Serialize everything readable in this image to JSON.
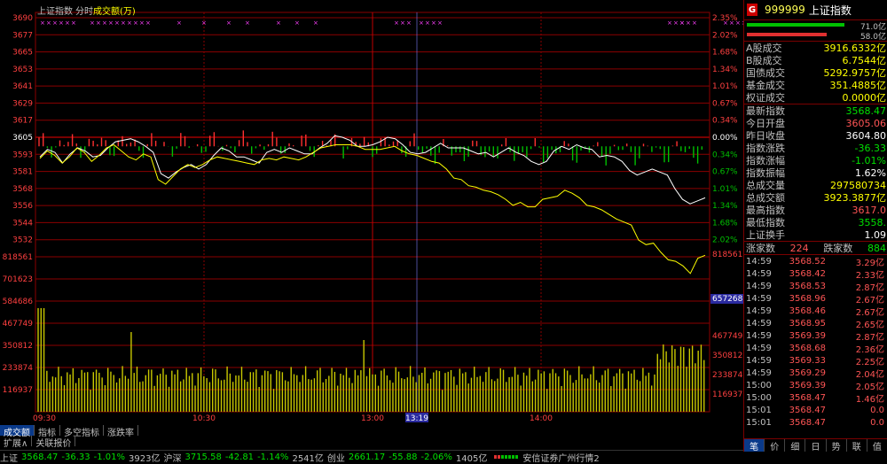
{
  "chart": {
    "header_index": "上证指数",
    "header_period": "分时",
    "header_measure": "成交额(万)",
    "price_ticks_left": [
      "3690",
      "3677",
      "3665",
      "3653",
      "3641",
      "3629",
      "3617",
      "3605",
      "3593",
      "3581",
      "3568",
      "3556",
      "3544",
      "3532"
    ],
    "pct_ticks_right": [
      "2.35%",
      "2.02%",
      "1.68%",
      "1.34%",
      "1.01%",
      "0.67%",
      "0.34%",
      "0.00%",
      "0.34%",
      "0.67%",
      "1.01%",
      "1.34%",
      "1.68%",
      "2.02%"
    ],
    "vol_ticks_left": [
      "818561",
      "701623",
      "584686",
      "467749",
      "350812",
      "233874",
      "116937"
    ],
    "vol_ticks_right": [
      "818561",
      "657268",
      "467749",
      "350812",
      "233874",
      "116937"
    ],
    "cursor_value": "657268",
    "time_labels": [
      "09:30",
      "10:30",
      "13:00",
      "13:19",
      "14:00"
    ],
    "colors": {
      "grid": "#8b0000",
      "white_line": "#ffffff",
      "yellow_line": "#ffff00",
      "up": "#ff3030",
      "down": "#00c000",
      "volume": "#c8c800",
      "cursor_box": "#2a2aa0"
    }
  },
  "chart_data": {
    "type": "line",
    "series": [
      {
        "values": [
          3598,
          3603,
          3601,
          3594,
          3600,
          3604,
          3602,
          3598,
          3599,
          3604,
          3608,
          3609,
          3610,
          3608,
          3605,
          3601,
          3587,
          3584,
          3588,
          3591,
          3593,
          3590,
          3593,
          3599,
          3604,
          3602,
          3598,
          3598,
          3596,
          3594,
          3601,
          3603,
          3601,
          3604,
          3602,
          3600,
          3600,
          3604,
          3607,
          3612,
          3611,
          3609,
          3605,
          3605,
          3606,
          3608,
          3611,
          3610,
          3606,
          3601,
          3600,
          3601,
          3604,
          3607,
          3604,
          3604,
          3604,
          3602,
          3600,
          3601,
          3598,
          3601,
          3604,
          3601,
          3599,
          3595,
          3593,
          3595,
          3602,
          3605,
          3603,
          3606,
          3604,
          3603,
          3598,
          3599,
          3598,
          3595,
          3589,
          3586,
          3588,
          3590,
          3588,
          3586,
          3577,
          3570,
          3567,
          3569,
          3571
        ]
      },
      {
        "values": [
          3597,
          3602,
          3599,
          3594,
          3598,
          3604,
          3601,
          3595,
          3599,
          3604,
          3606,
          3602,
          3598,
          3596,
          3600,
          3598,
          3583,
          3580,
          3585,
          3590,
          3593,
          3591,
          3593,
          3596,
          3598,
          3597,
          3596,
          3595,
          3594,
          3593,
          3596,
          3597,
          3596,
          3598,
          3597,
          3596,
          3598,
          3601,
          3604,
          3605,
          3606,
          3606,
          3606,
          3605,
          3603,
          3603,
          3603,
          3604,
          3605,
          3602,
          3600,
          3599,
          3597,
          3595,
          3594,
          3590,
          3584,
          3583,
          3579,
          3578,
          3576,
          3575,
          3573,
          3570,
          3566,
          3568,
          3565,
          3565,
          3570,
          3571,
          3572,
          3576,
          3574,
          3571,
          3566,
          3565,
          3563,
          3560,
          3557,
          3555,
          3553,
          3543,
          3540,
          3541,
          3535,
          3530,
          3529,
          3526,
          3521,
          3531,
          3533
        ]
      }
    ],
    "ylim": [
      3532,
      3690
    ],
    "baseline": 3605
  },
  "panel": {
    "code": "999999",
    "name": "上证指数",
    "bar_value_1": "71.0亿",
    "bar_value_2": "58.0亿",
    "stats1": [
      {
        "label": "A股成交",
        "value": "3916.6332亿",
        "color": "#ffff00"
      },
      {
        "label": "B股成交",
        "value": "6.7544亿",
        "color": "#ffff00"
      },
      {
        "label": "国债成交",
        "value": "5292.9757亿",
        "color": "#ffff00"
      },
      {
        "label": "基金成交",
        "value": "351.4885亿",
        "color": "#ffff00"
      },
      {
        "label": "权证成交",
        "value": "0.0000亿",
        "color": "#ffff00"
      }
    ],
    "stats2": [
      {
        "label": "最新指数",
        "value": "3568.47",
        "color": "#00e000"
      },
      {
        "label": "今日开盘",
        "value": "3605.06",
        "color": "#ff5555"
      },
      {
        "label": "昨日收盘",
        "value": "3604.80",
        "color": "#ffffff"
      },
      {
        "label": "指数涨跌",
        "value": "-36.33",
        "color": "#00e000"
      },
      {
        "label": "指数涨幅",
        "value": "-1.01%",
        "color": "#00e000"
      },
      {
        "label": "指数振幅",
        "value": "1.62%",
        "color": "#ffffff"
      },
      {
        "label": "总成交量",
        "value": "297580734",
        "color": "#ffff00"
      },
      {
        "label": "总成交额",
        "value": "3923.3877亿",
        "color": "#ffff00"
      },
      {
        "label": "最高指数",
        "value": "3617.0",
        "color": "#ff5555"
      },
      {
        "label": "最低指数",
        "value": "3558.",
        "color": "#00e000"
      },
      {
        "label": "上证换手",
        "value": "1.09",
        "color": "#ffffff"
      }
    ],
    "rise_label": "涨家数",
    "rise_count": "224",
    "fall_label": "跌家数",
    "fall_count": "884",
    "ticks": [
      {
        "time": "14:59",
        "price": "3568.52",
        "chg": "3.29亿"
      },
      {
        "time": "14:59",
        "price": "3568.42",
        "chg": "2.33亿"
      },
      {
        "time": "14:59",
        "price": "3568.53",
        "chg": "2.87亿"
      },
      {
        "time": "14:59",
        "price": "3568.96",
        "chg": "2.67亿"
      },
      {
        "time": "14:59",
        "price": "3568.46",
        "chg": "2.67亿"
      },
      {
        "time": "14:59",
        "price": "3568.95",
        "chg": "2.65亿"
      },
      {
        "time": "14:59",
        "price": "3569.39",
        "chg": "2.87亿"
      },
      {
        "time": "14:59",
        "price": "3568.68",
        "chg": "2.36亿"
      },
      {
        "time": "14:59",
        "price": "3569.33",
        "chg": "2.25亿"
      },
      {
        "time": "14:59",
        "price": "3569.29",
        "chg": "2.04亿"
      },
      {
        "time": "15:00",
        "price": "3569.39",
        "chg": "2.05亿"
      },
      {
        "time": "15:00",
        "price": "3568.47",
        "chg": "1.46亿"
      },
      {
        "time": "15:01",
        "price": "3568.47",
        "chg": "0.0"
      },
      {
        "time": "15:01",
        "price": "3568.47",
        "chg": "0.0"
      }
    ],
    "tabs": [
      "笔",
      "价",
      "细",
      "日",
      "势",
      "联",
      "值"
    ]
  },
  "tabs_row1": [
    "成交额",
    "指标",
    "多空指标",
    "涨跌率"
  ],
  "tabs_row2": [
    "扩展∧",
    "关联报价"
  ],
  "status": {
    "sh_label": "上证",
    "sh_val": "3568.47",
    "sh_chg": "-36.33",
    "sh_pct": "-1.01%",
    "sh_amt": "3923亿",
    "hs_label": "沪深",
    "hs_val": "3715.58",
    "hs_chg": "-42.81",
    "hs_pct": "-1.14%",
    "hs_amt": "2541亿",
    "cy_label": "创业",
    "cy_val": "2661.17",
    "cy_chg": "-55.88",
    "cy_pct": "-2.06%",
    "cy_amt": "1405亿",
    "broker": "安信证券广州行情2"
  }
}
